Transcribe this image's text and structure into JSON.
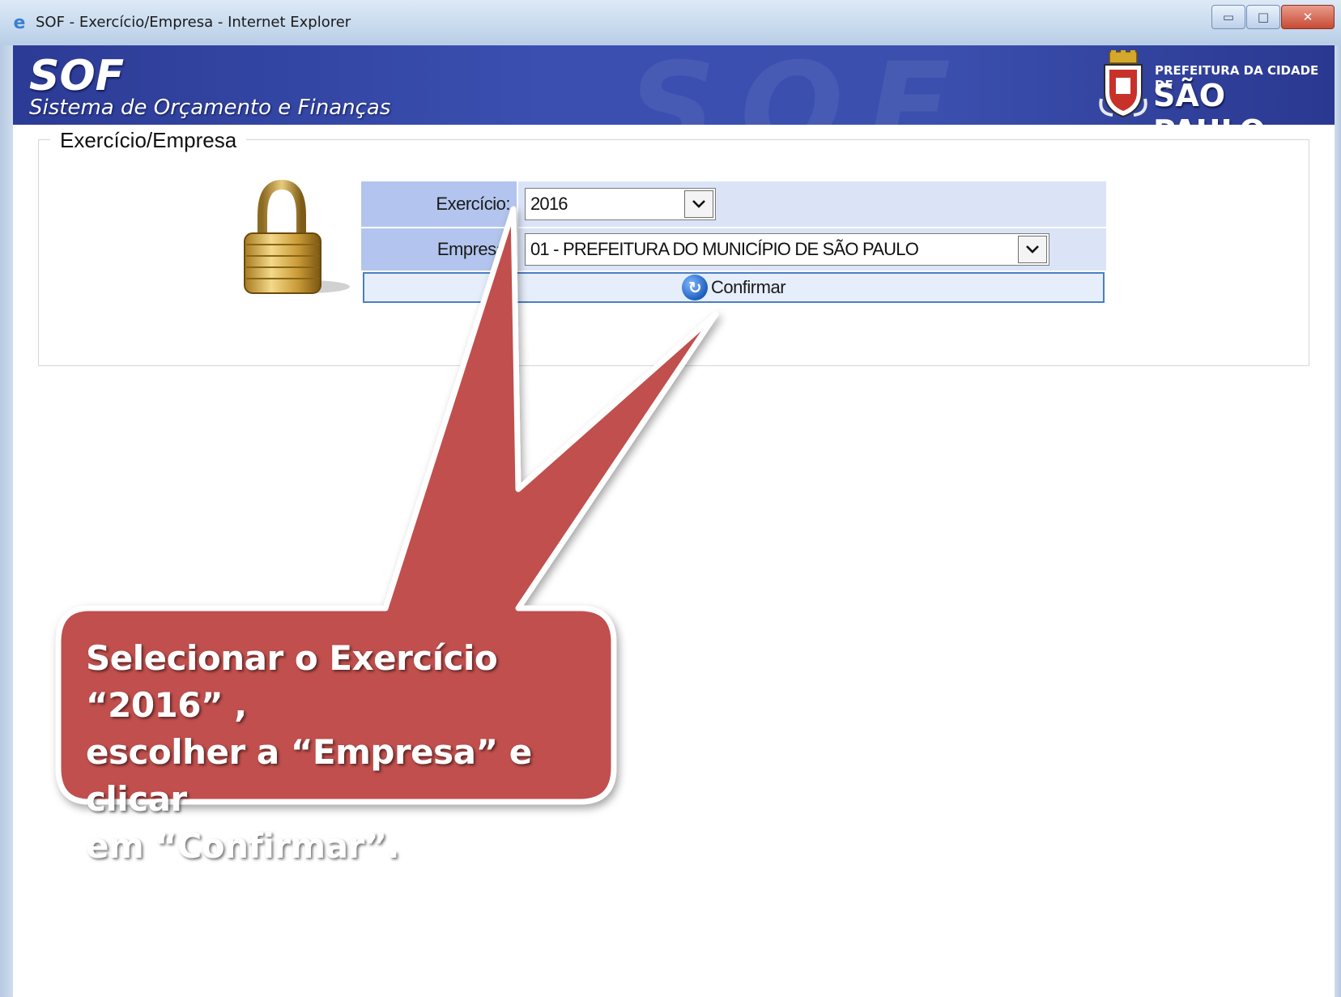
{
  "window": {
    "title": "SOF - Exercício/Empresa - Internet Explorer",
    "minimize_glyph": "▭",
    "maximize_glyph": "□",
    "close_glyph": "✕"
  },
  "banner": {
    "app_name": "SOF",
    "app_subtitle": "Sistema de Orçamento e Finanças",
    "watermark": "SOF",
    "pref_line1": "PREFEITURA DA CIDADE DE",
    "pref_line2": "SÃO PAULO"
  },
  "form": {
    "group_title": "Exercício/Empresa",
    "exercicio_label": "Exercício:",
    "exercicio_value": "2016",
    "empresa_label": "Empresa:",
    "empresa_value": "01 - PREFEITURA DO MUNICÍPIO DE SÃO PAULO",
    "confirm_label": "Confirmar"
  },
  "callout": {
    "line1": "Selecionar o Exercício “2016” ,",
    "line2": "escolher a  “Empresa”  e clicar",
    "line3": "em “Confirmar”."
  },
  "colors": {
    "banner": "#3a4fb0",
    "label_cell": "#b3c5ee",
    "value_cell": "#dbe4f7",
    "callout": "#c0504d"
  }
}
